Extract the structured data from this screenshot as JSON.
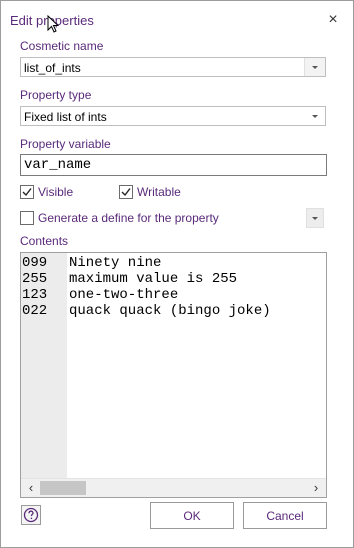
{
  "window": {
    "title": "Edit properties",
    "close_glyph": "×"
  },
  "fields": {
    "cosmetic_name": {
      "label": "Cosmetic name",
      "value": "list_of_ints"
    },
    "property_type": {
      "label": "Property type",
      "value": "Fixed list of ints"
    },
    "property_variable": {
      "label": "Property variable",
      "value": "var_name"
    }
  },
  "checkboxes": {
    "visible": {
      "label": "Visible",
      "checked": true
    },
    "writable": {
      "label": "Writable",
      "checked": true
    },
    "generate_define": {
      "label": "Generate a define for the property",
      "checked": false
    }
  },
  "contents": {
    "label": "Contents",
    "lines": [
      {
        "num": "099",
        "text": "Ninety nine"
      },
      {
        "num": "255",
        "text": "maximum value is 255"
      },
      {
        "num": "123",
        "text": "one-two-three"
      },
      {
        "num": "022",
        "text": "quack quack (bingo joke)"
      }
    ]
  },
  "buttons": {
    "ok": "OK",
    "cancel": "Cancel"
  },
  "icons": {
    "help": "help-icon",
    "close": "close-icon",
    "dropdown": "chevron-down-icon",
    "scroll_left": "chevron-left-icon",
    "scroll_right": "chevron-right-icon"
  },
  "colors": {
    "accent_text": "#5a2a7a"
  }
}
